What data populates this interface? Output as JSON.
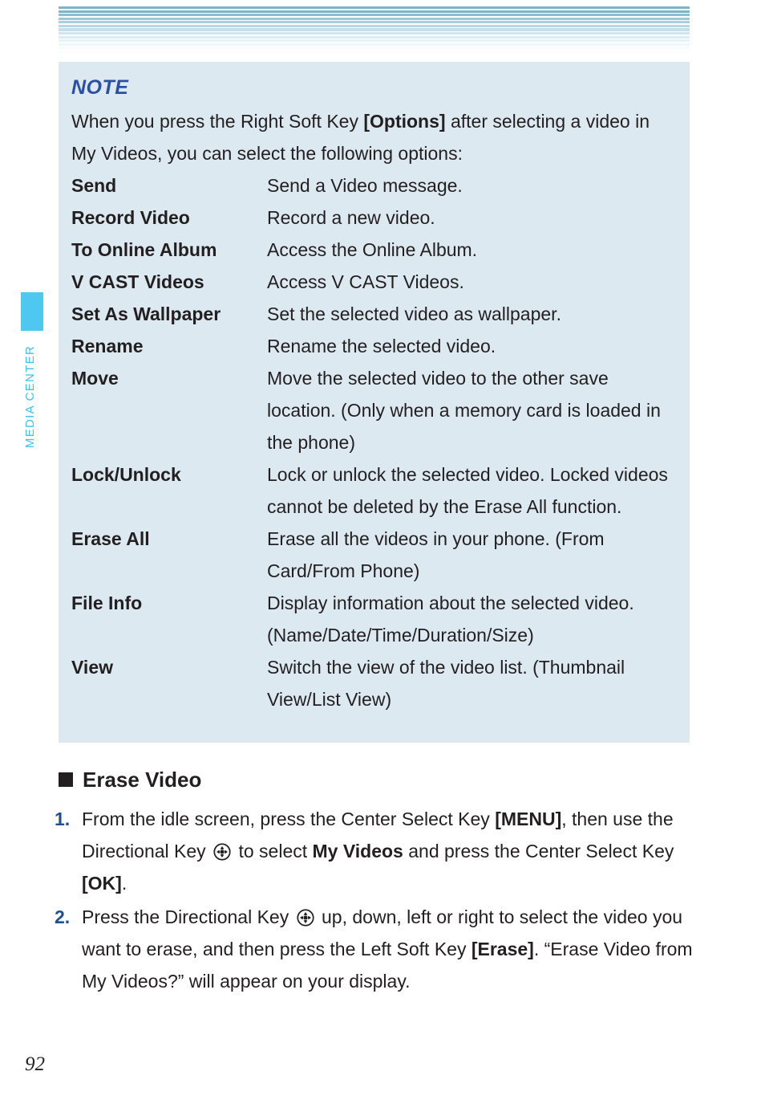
{
  "page": {
    "number": "92",
    "chapter_tab_label": "MEDIA CENTER",
    "accent_cyan": "#4ec8f0",
    "note_bg": "#dce9f1",
    "note_heading_color": "#2b4fa6",
    "step_number_color": "#1d4f91"
  },
  "header": {
    "stripe_colors": [
      "#7cb4c8",
      "#7cb4c8",
      "#8dbfd0",
      "#9cc8d8",
      "#a9d0de",
      "#b6d8e4",
      "#c3dfea",
      "#cfe6ef",
      "#dbedf4",
      "#e6f2f7",
      "#eff7fa",
      "#f7fbfc",
      "#fcfdfe"
    ]
  },
  "note": {
    "heading": "NOTE",
    "intro_part1": "When you press the Right Soft Key ",
    "intro_bold": "[Options]",
    "intro_part2": " after selecting a video in My Videos, you can select the following options:",
    "options": [
      {
        "term": "Send",
        "desc": "Send a Video message."
      },
      {
        "term": "Record Video",
        "desc": "Record a new video."
      },
      {
        "term": "To Online Album",
        "desc": "Access the Online Album."
      },
      {
        "term": "V CAST Videos",
        "desc": "Access V CAST Videos."
      },
      {
        "term": "Set As Wallpaper",
        "desc": "Set the selected video as wallpaper."
      },
      {
        "term": "Rename",
        "desc": "Rename the selected video."
      },
      {
        "term": "Move",
        "desc": "Move the selected video to the other save location. (Only when a memory card is loaded in the phone)"
      },
      {
        "term": "Lock/Unlock",
        "desc": "Lock or unlock the selected video. Locked videos cannot be deleted by the Erase All function."
      },
      {
        "term": "Erase All",
        "desc": "Erase all the videos in your phone. (From Card/From Phone)"
      },
      {
        "term": "File Info",
        "desc": "Display information about the selected video. (Name/Date/Time/Duration/Size)"
      },
      {
        "term": "View",
        "desc": "Switch the view of the video list. (Thumbnail View/List View)"
      }
    ]
  },
  "section": {
    "heading": "Erase Video",
    "bullet_icon": "square-bullet-icon",
    "steps": [
      {
        "number": "1.",
        "segments": [
          {
            "type": "text",
            "value": "From the idle screen, press the Center Select Key "
          },
          {
            "type": "bold",
            "value": "[MENU]"
          },
          {
            "type": "text",
            "value": ", then use the Directional Key "
          },
          {
            "type": "icon",
            "value": "directional-key-icon"
          },
          {
            "type": "text",
            "value": " to select "
          },
          {
            "type": "bold",
            "value": "My Videos"
          },
          {
            "type": "text",
            "value": " and press the Center Select Key "
          },
          {
            "type": "bold",
            "value": "[OK]"
          },
          {
            "type": "text",
            "value": "."
          }
        ]
      },
      {
        "number": "2.",
        "segments": [
          {
            "type": "text",
            "value": "Press the Directional Key "
          },
          {
            "type": "icon",
            "value": "directional-key-icon"
          },
          {
            "type": "text",
            "value": " up, down, left or right to select the video you want to erase, and then press the Left Soft Key "
          },
          {
            "type": "bold",
            "value": "[Erase]"
          },
          {
            "type": "text",
            "value": ". “Erase Video from My Videos?” will appear on your display."
          }
        ]
      }
    ]
  }
}
